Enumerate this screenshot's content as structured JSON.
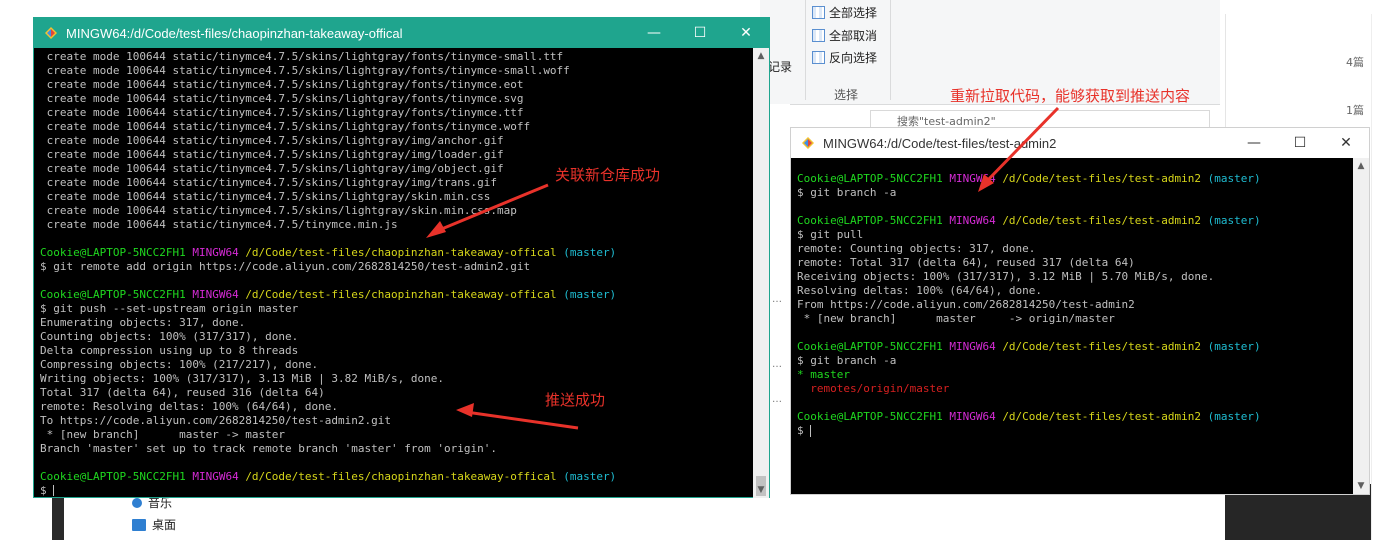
{
  "explorer": {
    "ribbon": {
      "select_all": "全部选择",
      "select_none": "全部取消",
      "invert_selection": "反向选择",
      "group_label": "选择",
      "history_label": "记录"
    },
    "search_placeholder": "搜索\"test-admin2\"",
    "stats": [
      "4篇",
      "1篇"
    ],
    "nav_items": [
      "音乐",
      "桌面"
    ]
  },
  "terminal1": {
    "title": "MINGW64:/d/Code/test-files/chaopinzhan-takeaway-offical",
    "lines": [
      [
        {
          "t": " create mode 100644 static/tinymce4.7.5/skins/lightgray/fonts/tinymce-small.ttf"
        }
      ],
      [
        {
          "t": " create mode 100644 static/tinymce4.7.5/skins/lightgray/fonts/tinymce-small.woff"
        }
      ],
      [
        {
          "t": " create mode 100644 static/tinymce4.7.5/skins/lightgray/fonts/tinymce.eot"
        }
      ],
      [
        {
          "t": " create mode 100644 static/tinymce4.7.5/skins/lightgray/fonts/tinymce.svg"
        }
      ],
      [
        {
          "t": " create mode 100644 static/tinymce4.7.5/skins/lightgray/fonts/tinymce.ttf"
        }
      ],
      [
        {
          "t": " create mode 100644 static/tinymce4.7.5/skins/lightgray/fonts/tinymce.woff"
        }
      ],
      [
        {
          "t": " create mode 100644 static/tinymce4.7.5/skins/lightgray/img/anchor.gif"
        }
      ],
      [
        {
          "t": " create mode 100644 static/tinymce4.7.5/skins/lightgray/img/loader.gif"
        }
      ],
      [
        {
          "t": " create mode 100644 static/tinymce4.7.5/skins/lightgray/img/object.gif"
        }
      ],
      [
        {
          "t": " create mode 100644 static/tinymce4.7.5/skins/lightgray/img/trans.gif"
        }
      ],
      [
        {
          "t": " create mode 100644 static/tinymce4.7.5/skins/lightgray/skin.min.css"
        }
      ],
      [
        {
          "t": " create mode 100644 static/tinymce4.7.5/skins/lightgray/skin.min.css.map"
        }
      ],
      [
        {
          "t": " create mode 100644 static/tinymce4.7.5/tinymce.min.js"
        }
      ],
      [
        {
          "t": ""
        }
      ],
      [
        {
          "t": "Cookie@LAPTOP-5NCC2FH1 ",
          "c": "green"
        },
        {
          "t": "MINGW64 ",
          "c": "mag"
        },
        {
          "t": "/d/Code/test-files/chaopinzhan-takeaway-offical ",
          "c": "yel"
        },
        {
          "t": "(master)",
          "c": "cyan"
        }
      ],
      [
        {
          "t": "$ git remote add origin https://code.aliyun.com/2682814250/test-admin2.git"
        }
      ],
      [
        {
          "t": ""
        }
      ],
      [
        {
          "t": "Cookie@LAPTOP-5NCC2FH1 ",
          "c": "green"
        },
        {
          "t": "MINGW64 ",
          "c": "mag"
        },
        {
          "t": "/d/Code/test-files/chaopinzhan-takeaway-offical ",
          "c": "yel"
        },
        {
          "t": "(master)",
          "c": "cyan"
        }
      ],
      [
        {
          "t": "$ git push --set-upstream origin master"
        }
      ],
      [
        {
          "t": "Enumerating objects: 317, done."
        }
      ],
      [
        {
          "t": "Counting objects: 100% (317/317), done."
        }
      ],
      [
        {
          "t": "Delta compression using up to 8 threads"
        }
      ],
      [
        {
          "t": "Compressing objects: 100% (217/217), done."
        }
      ],
      [
        {
          "t": "Writing objects: 100% (317/317), 3.13 MiB | 3.82 MiB/s, done."
        }
      ],
      [
        {
          "t": "Total 317 (delta 64), reused 316 (delta 64)"
        }
      ],
      [
        {
          "t": "remote: Resolving deltas: 100% (64/64), done."
        }
      ],
      [
        {
          "t": "To https://code.aliyun.com/2682814250/test-admin2.git"
        }
      ],
      [
        {
          "t": " * [new branch]      master -> master"
        }
      ],
      [
        {
          "t": "Branch 'master' set up to track remote branch 'master' from 'origin'."
        }
      ],
      [
        {
          "t": ""
        }
      ],
      [
        {
          "t": "Cookie@LAPTOP-5NCC2FH1 ",
          "c": "green"
        },
        {
          "t": "MINGW64 ",
          "c": "mag"
        },
        {
          "t": "/d/Code/test-files/chaopinzhan-takeaway-offical ",
          "c": "yel"
        },
        {
          "t": "(master)",
          "c": "cyan"
        }
      ],
      [
        {
          "t": "$ ",
          "cursor": true
        }
      ]
    ]
  },
  "terminal2": {
    "title": "MINGW64:/d/Code/test-files/test-admin2",
    "lines": [
      [
        {
          "t": "Cookie@LAPTOP-5NCC2FH1 ",
          "c": "green"
        },
        {
          "t": "MINGW64 ",
          "c": "mag"
        },
        {
          "t": "/d/Code/test-files/test-admin2 ",
          "c": "yel"
        },
        {
          "t": "(master)",
          "c": "cyan"
        }
      ],
      [
        {
          "t": "$ git branch -a"
        }
      ],
      [
        {
          "t": ""
        }
      ],
      [
        {
          "t": "Cookie@LAPTOP-5NCC2FH1 ",
          "c": "green"
        },
        {
          "t": "MINGW64 ",
          "c": "mag"
        },
        {
          "t": "/d/Code/test-files/test-admin2 ",
          "c": "yel"
        },
        {
          "t": "(master)",
          "c": "cyan"
        }
      ],
      [
        {
          "t": "$ git pull"
        }
      ],
      [
        {
          "t": "remote: Counting objects: 317, done."
        }
      ],
      [
        {
          "t": "remote: Total 317 (delta 64), reused 317 (delta 64)"
        }
      ],
      [
        {
          "t": "Receiving objects: 100% (317/317), 3.12 MiB | 5.70 MiB/s, done."
        }
      ],
      [
        {
          "t": "Resolving deltas: 100% (64/64), done."
        }
      ],
      [
        {
          "t": "From https://code.aliyun.com/2682814250/test-admin2"
        }
      ],
      [
        {
          "t": " * [new branch]      master     -> origin/master"
        }
      ],
      [
        {
          "t": ""
        }
      ],
      [
        {
          "t": "Cookie@LAPTOP-5NCC2FH1 ",
          "c": "green"
        },
        {
          "t": "MINGW64 ",
          "c": "mag"
        },
        {
          "t": "/d/Code/test-files/test-admin2 ",
          "c": "yel"
        },
        {
          "t": "(master)",
          "c": "cyan"
        }
      ],
      [
        {
          "t": "$ git branch -a"
        }
      ],
      [
        {
          "t": "* master",
          "c": "green"
        }
      ],
      [
        {
          "t": "  remotes/origin/master",
          "c": "red"
        }
      ],
      [
        {
          "t": ""
        }
      ],
      [
        {
          "t": "Cookie@LAPTOP-5NCC2FH1 ",
          "c": "green"
        },
        {
          "t": "MINGW64 ",
          "c": "mag"
        },
        {
          "t": "/d/Code/test-files/test-admin2 ",
          "c": "yel"
        },
        {
          "t": "(master)",
          "c": "cyan"
        }
      ],
      [
        {
          "t": "$ ",
          "cursor": true
        }
      ]
    ]
  },
  "annotations": {
    "associate_success": "关联新仓库成功",
    "push_success": "推送成功",
    "pull_note": "重新拉取代码，能够获取到推送内容"
  },
  "window_buttons": {
    "minimize": "—",
    "maximize": "☐",
    "close": "✕"
  },
  "colors": {
    "terminal1_titlebar": "#1fa58e",
    "annotation": "#e8322a",
    "prompt_user": "#1fd81f",
    "prompt_mingw": "#d62bd6",
    "prompt_path": "#d6d61a",
    "prompt_branch": "#1fbcd1"
  }
}
